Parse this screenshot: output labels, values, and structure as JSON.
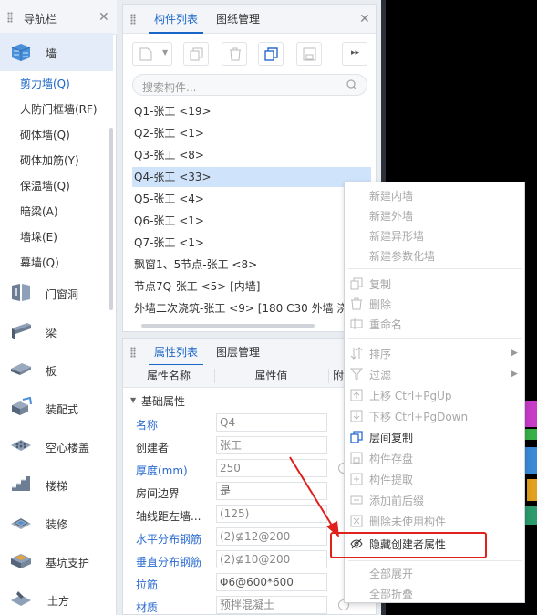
{
  "nav": {
    "title": "导航栏",
    "categories": [
      {
        "icon": "wall-icon",
        "label": "墙"
      },
      {
        "icon": "door-window-icon",
        "label": "门窗洞"
      },
      {
        "icon": "beam-icon",
        "label": "梁"
      },
      {
        "icon": "slab-icon",
        "label": "板"
      },
      {
        "icon": "prefab-icon",
        "label": "装配式"
      },
      {
        "icon": "hollow-floor-icon",
        "label": "空心楼盖"
      },
      {
        "icon": "stair-icon",
        "label": "楼梯"
      },
      {
        "icon": "decoration-icon",
        "label": "装修"
      },
      {
        "icon": "pit-support-icon",
        "label": "基坑支护"
      },
      {
        "icon": "earthwork-icon",
        "label": "土方"
      }
    ],
    "wall_subitems": [
      "剪力墙(Q)",
      "人防门框墙(RF)",
      "砌体墙(Q)",
      "砌体加筋(Y)",
      "保温墙(Q)",
      "暗梁(A)",
      "墙垛(E)",
      "幕墙(Q)"
    ]
  },
  "components_panel": {
    "tabs": [
      "构件列表",
      "图纸管理"
    ],
    "search_placeholder": "搜索构件...",
    "items": [
      "Q1-张工 <19>",
      "Q2-张工 <1>",
      "Q3-张工 <8>",
      "Q4-张工 <33>",
      "Q5-张工 <4>",
      "Q6-张工 <1>",
      "Q7-张工 <1>",
      "飘窗1、5节点-张工 <8>",
      "节点7Q-张工 <5> [内墙]",
      "外墙二次浇筑-张工 <9> [180 C30 外墙 浇"
    ]
  },
  "properties_panel": {
    "tabs": [
      "属性列表",
      "图层管理"
    ],
    "columns": [
      "属性名称",
      "属性值",
      "附"
    ],
    "group": "基础属性",
    "rows": [
      {
        "name": "名称",
        "value": "Q4"
      },
      {
        "name": "创建者",
        "value": "张工"
      },
      {
        "name": "厚度(mm)",
        "value": "250"
      },
      {
        "name": "房间边界",
        "value": "是"
      },
      {
        "name": "轴线距左墙...",
        "value": "(125)"
      },
      {
        "name": "水平分布钢筋",
        "value": "(2)⊈12@200"
      },
      {
        "name": "垂直分布钢筋",
        "value": "(2)⊈10@200"
      },
      {
        "name": "拉筋",
        "value": "Φ6@600*600"
      },
      {
        "name": "材质",
        "value": "预拌混凝土"
      }
    ]
  },
  "context_menu": {
    "items": [
      {
        "label": "新建内墙",
        "enabled": false
      },
      {
        "label": "新建外墙",
        "enabled": false
      },
      {
        "label": "新建异形墙",
        "enabled": false
      },
      {
        "label": "新建参数化墙",
        "enabled": false
      },
      {
        "label": "复制",
        "enabled": false,
        "icon": "copy-icon"
      },
      {
        "label": "删除",
        "enabled": false,
        "icon": "delete-icon"
      },
      {
        "label": "重命名",
        "enabled": false,
        "icon": "rename-icon"
      },
      {
        "label": "排序",
        "enabled": false,
        "icon": "sort-icon",
        "submenu": true
      },
      {
        "label": "过滤",
        "enabled": false,
        "icon": "filter-icon",
        "submenu": true
      },
      {
        "label": "上移 Ctrl+PgUp",
        "enabled": false,
        "icon": "move-up-icon"
      },
      {
        "label": "下移 Ctrl+PgDown",
        "enabled": false,
        "icon": "move-down-icon"
      },
      {
        "label": "层间复制",
        "enabled": true,
        "icon": "floor-copy-icon"
      },
      {
        "label": "构件存盘",
        "enabled": false,
        "icon": "save-component-icon"
      },
      {
        "label": "构件提取",
        "enabled": false,
        "icon": "extract-component-icon"
      },
      {
        "label": "添加前后缀",
        "enabled": false,
        "icon": "affix-icon"
      },
      {
        "label": "删除未使用构件",
        "enabled": false,
        "icon": "delete-unused-icon"
      },
      {
        "label": "隐藏创建者属性",
        "enabled": true,
        "icon": "hide-eye-icon"
      },
      {
        "label": "全部展开",
        "enabled": false
      },
      {
        "label": "全部折叠",
        "enabled": false
      }
    ]
  },
  "colors": {
    "accent": "#1a66c8",
    "selection": "#cfe3fb",
    "highlight": "#e0201a"
  }
}
